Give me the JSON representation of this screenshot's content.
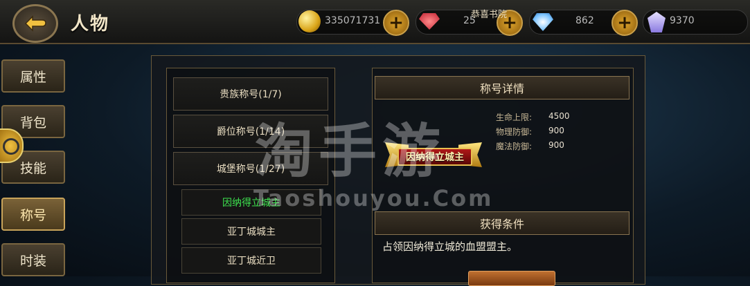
{
  "header": {
    "title": "人物",
    "back_icon": "back-arrow-icon",
    "notice": "恭喜书院",
    "gold": {
      "value": "335071731",
      "icon": "gold-coin-icon"
    },
    "ruby": {
      "value": "25",
      "icon": "red-gem-icon"
    },
    "diamond": {
      "value": "862",
      "icon": "locked-diamond-icon"
    },
    "crystal": {
      "value": "9370",
      "icon": "purple-crystal-icon"
    }
  },
  "sidebar": {
    "items": [
      {
        "label": "属性",
        "active": false
      },
      {
        "label": "背包",
        "active": false
      },
      {
        "label": "技能",
        "active": false
      },
      {
        "label": "称号",
        "active": true
      },
      {
        "label": "时装",
        "active": false
      }
    ]
  },
  "title_list": {
    "categories": [
      {
        "label": "贵族称号(1/7)"
      },
      {
        "label": "爵位称号(1/14)"
      },
      {
        "label": "城堡称号(1/27)"
      }
    ],
    "items": [
      {
        "label": "因纳得立城主",
        "selected": true
      },
      {
        "label": "亚丁城城主",
        "selected": false
      },
      {
        "label": "亚丁城近卫",
        "selected": false
      }
    ]
  },
  "detail": {
    "header": "称号详情",
    "badge_text": "因纳得立城主",
    "stats": [
      {
        "label": "生命上限:",
        "value": "4500"
      },
      {
        "label": "物理防御:",
        "value": "900"
      },
      {
        "label": "魔法防御:",
        "value": "900"
      }
    ],
    "condition_header": "获得条件",
    "condition_text": "占领因纳得立城的血盟盟主。"
  },
  "watermark": {
    "main": "淘手游",
    "sub": "Taoshouyou.Com"
  },
  "colors": {
    "selected_text": "#3ee650",
    "accent_gold": "#c9a45a"
  }
}
